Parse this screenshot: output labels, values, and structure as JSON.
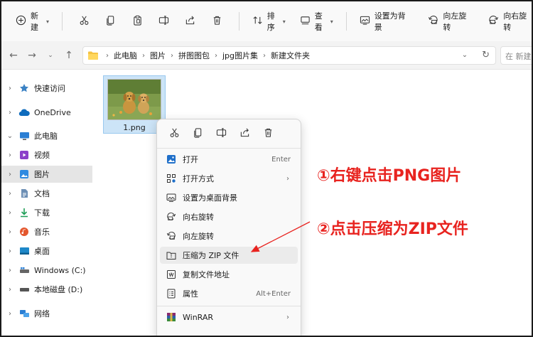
{
  "toolbar": {
    "new_label": "新建",
    "sort_label": "排序",
    "view_label": "查看",
    "set_bg_label": "设置为背景",
    "rotate_left_label": "向左旋转",
    "rotate_right_label": "向右旋转"
  },
  "address": {
    "breadcrumbs": [
      "此电脑",
      "图片",
      "拼图图包",
      "jpg图片集",
      "新建文件夹"
    ],
    "search_placeholder": "在 新建"
  },
  "sidebar": {
    "items": [
      {
        "label": "快速访问"
      },
      {
        "label": "OneDrive"
      },
      {
        "label": "此电脑"
      },
      {
        "label": "视频"
      },
      {
        "label": "图片"
      },
      {
        "label": "文档"
      },
      {
        "label": "下载"
      },
      {
        "label": "音乐"
      },
      {
        "label": "桌面"
      },
      {
        "label": "Windows (C:)"
      },
      {
        "label": "本地磁盘 (D:)"
      },
      {
        "label": "网络"
      }
    ]
  },
  "file": {
    "name": "1.png"
  },
  "context_menu": {
    "items": [
      {
        "label": "打开",
        "shortcut": "Enter"
      },
      {
        "label": "打开方式"
      },
      {
        "label": "设置为桌面背景"
      },
      {
        "label": "向右旋转"
      },
      {
        "label": "向左旋转"
      },
      {
        "label": "压缩为 ZIP 文件"
      },
      {
        "label": "复制文件地址"
      },
      {
        "label": "属性",
        "shortcut": "Alt+Enter"
      },
      {
        "label": "WinRAR"
      }
    ]
  },
  "annotations": {
    "step1": "①右键点击PNG图片",
    "step2": "②点击压缩为ZIP文件"
  },
  "colors": {
    "annotation": "#e8231f",
    "selection": "#cce4f7",
    "accent": "#0067c0"
  }
}
